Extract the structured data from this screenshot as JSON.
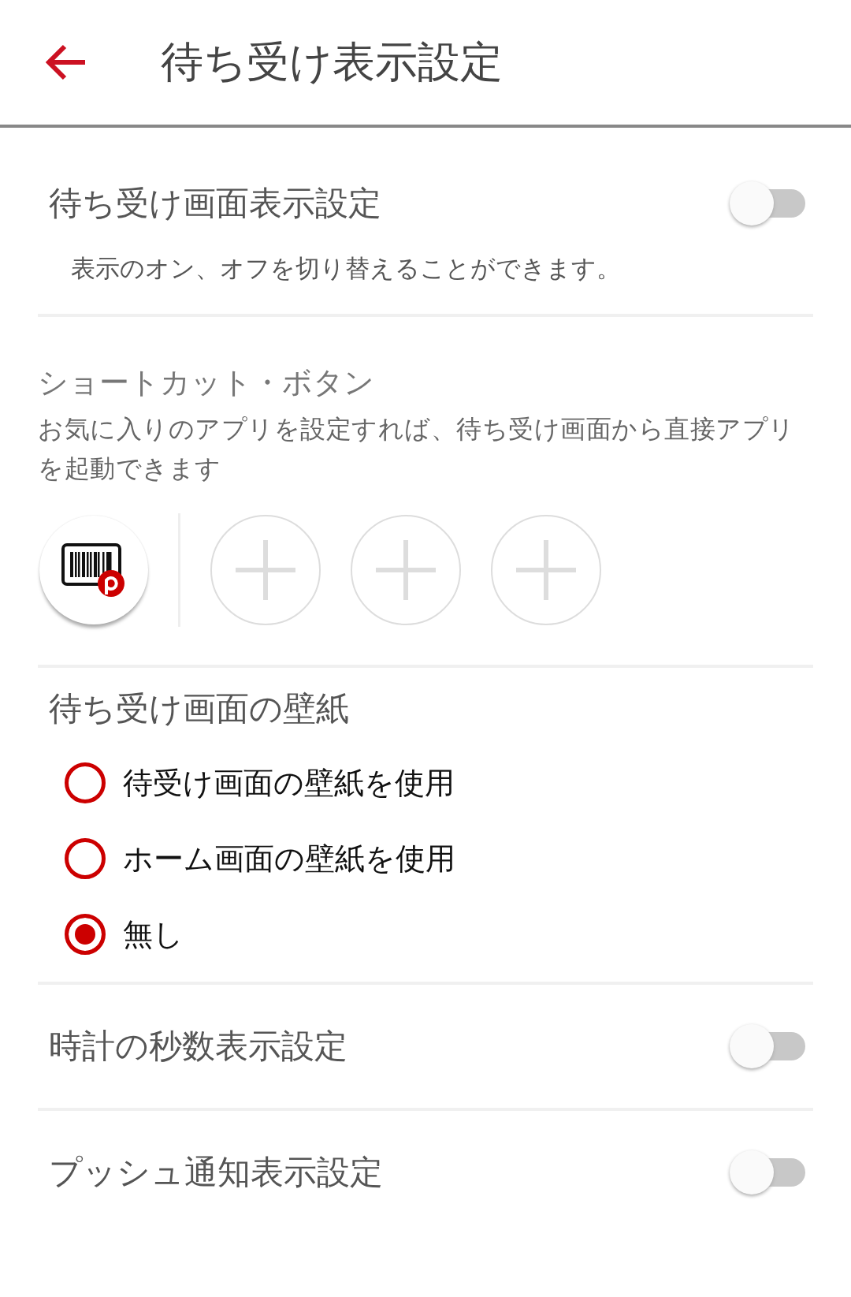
{
  "header": {
    "title": "待ち受け表示設定"
  },
  "display_setting": {
    "title": "待ち受け画面表示設定",
    "on": false,
    "description": "表示のオン、オフを切り替えることができます。"
  },
  "shortcuts": {
    "title": "ショートカット・ボタン",
    "description": "お気に入りのアプリを設定すれば、待ち受け画面から直接アプリを起動できます",
    "slots": [
      {
        "kind": "app"
      },
      {
        "kind": "empty"
      },
      {
        "kind": "empty"
      },
      {
        "kind": "empty"
      }
    ]
  },
  "wallpaper": {
    "title": "待ち受け画面の壁紙",
    "options": [
      {
        "label": "待受け画面の壁紙を使用",
        "selected": false
      },
      {
        "label": "ホーム画面の壁紙を使用",
        "selected": false
      },
      {
        "label": "無し",
        "selected": true
      }
    ]
  },
  "toggles": [
    {
      "label": "時計の秒数表示設定",
      "on": false
    },
    {
      "label": "プッシュ通知表示設定",
      "on": false
    }
  ]
}
